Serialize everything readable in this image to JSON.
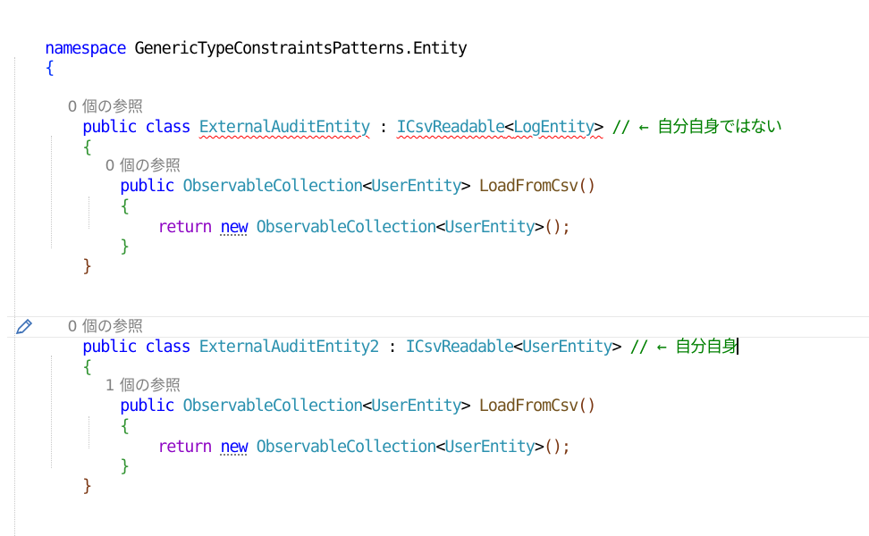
{
  "code": {
    "ns": {
      "keyword": "namespace",
      "name": "GenericTypeConstraintsPatterns.Entity"
    },
    "braces": {
      "open": "{",
      "close": "}"
    },
    "class1": {
      "refs": "0 個の参照",
      "mods": "public class",
      "name": "ExternalAuditEntity",
      "colon": ":",
      "iface": "ICsvReadable",
      "lt": "<",
      "typeArg": "LogEntity",
      "gt": ">",
      "comment": "// ← 自分自身ではない",
      "method": {
        "refs": "0 個の参照",
        "mod": "public",
        "retType": "ObservableCollection",
        "retArg": "UserEntity",
        "name": "LoadFromCsv",
        "parens": "()",
        "ret": "return",
        "newKw": "new",
        "newType": "ObservableCollection",
        "newArg": "UserEntity",
        "tail": "();"
      }
    },
    "class2": {
      "refs": "0 個の参照",
      "mods": "public class",
      "name": "ExternalAuditEntity2",
      "colon": ":",
      "iface": "ICsvReadable",
      "lt": "<",
      "typeArg": "UserEntity",
      "gt": ">",
      "comment": "// ← 自分自身",
      "method": {
        "refs": "1 個の参照",
        "mod": "public",
        "retType": "ObservableCollection",
        "retArg": "UserEntity",
        "name": "LoadFromCsv",
        "parens": "()",
        "ret": "return",
        "newKw": "new",
        "newType": "ObservableCollection",
        "newArg": "UserEntity",
        "tail": "();"
      }
    }
  },
  "colors": {
    "keyword": "#0000ff",
    "control": "#8f08c4",
    "type": "#2b91af",
    "method": "#74531f",
    "comment": "#008000",
    "error": "#ff0000",
    "lens": "#808080"
  },
  "icons": {
    "quick_action": "pencil-icon"
  }
}
